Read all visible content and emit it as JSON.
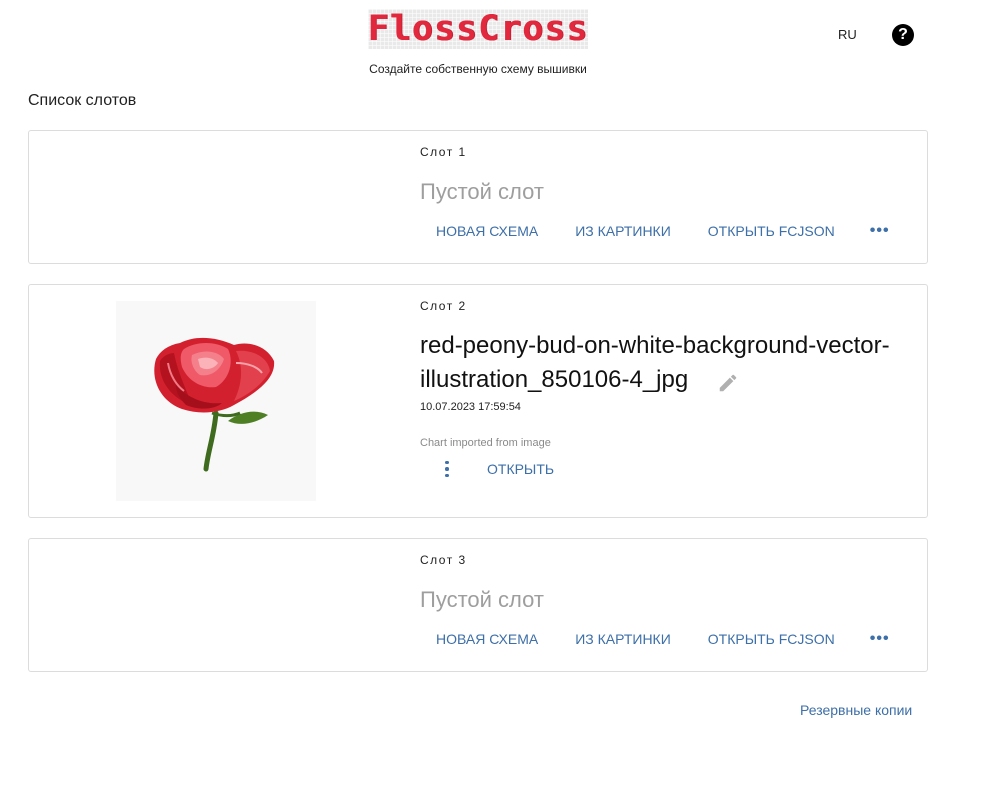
{
  "header": {
    "logo_text": "FlossCross",
    "tagline": "Создайте собственную схему вышивки",
    "language": "RU",
    "help_symbol": "?"
  },
  "list_title": "Список слотов",
  "slots": [
    {
      "label": "Слот 1",
      "empty_title": "Пустой слот",
      "actions": [
        "НОВАЯ СХЕМА",
        "ИЗ КАРТИНКИ",
        "ОТКРЫТЬ FCJSON",
        "•••"
      ]
    },
    {
      "label": "Слот 2",
      "file_name_line1": "red-peony-bud-on-white-background-vector-",
      "file_name_line2": "illustration_850106-4_jpg",
      "date": "10.07.2023 17:59:54",
      "note": "Chart imported from image",
      "open_label": "ОТКРЫТЬ",
      "thumbnail_icon": "red-peony-image"
    },
    {
      "label": "Слот 3",
      "empty_title": "Пустой слот",
      "actions": [
        "НОВАЯ СХЕМА",
        "ИЗ КАРТИНКИ",
        "ОТКРЫТЬ FCJSON",
        "•••"
      ]
    }
  ],
  "footer": {
    "backups_label": "Резервные копии"
  },
  "colors": {
    "accent": "#3d6fa8",
    "logo_red": "#e2283d",
    "muted": "#9e9e9e",
    "border": "#dcdcdc"
  }
}
